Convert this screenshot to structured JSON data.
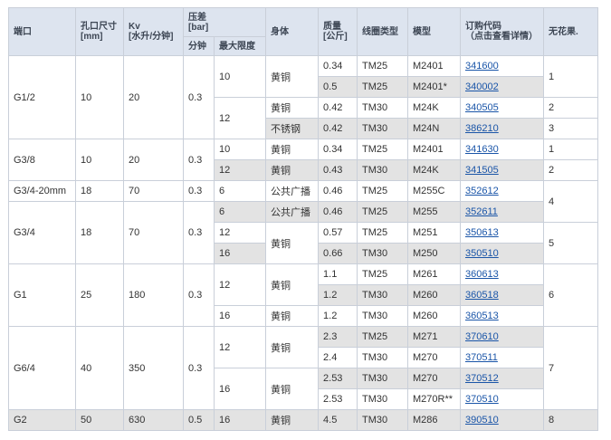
{
  "table": {
    "headers": {
      "port": "端口",
      "orifice_line1": "孔口尺寸",
      "orifice_line2": "[mm]",
      "kv_line1": "Kv",
      "kv_line2": "[水升/分钟]",
      "pressure_line1": "压差",
      "pressure_line2": "[bar]",
      "pressure_min": "分钟",
      "pressure_max": "最大限度",
      "body": "身体",
      "weight_line1": "质量",
      "weight_line2": "[公斤]",
      "coil": "线圈类型",
      "model": "模型",
      "order_line1": "订购代码",
      "order_line2": "（点击查看详情）",
      "no_flower": "无花果."
    },
    "groups": [
      {
        "port": "G1/2",
        "orifice": "10",
        "kv": "20",
        "pmin": "0.3"
      },
      {
        "port": "G3/8",
        "orifice": "10",
        "kv": "20",
        "pmin": "0.3"
      },
      {
        "port": "G3/4-20mm",
        "orifice": "18",
        "kv": "70",
        "pmin": "0.3"
      },
      {
        "port": "G3/4",
        "orifice": "18",
        "kv": "70",
        "pmin": "0.3"
      },
      {
        "port": "G1",
        "orifice": "25",
        "kv": "180",
        "pmin": "0.3"
      },
      {
        "port": "G6/4",
        "orifice": "40",
        "kv": "350",
        "pmin": "0.3"
      },
      {
        "port": "G2",
        "orifice": "50",
        "kv": "630",
        "pmin": "0.5"
      }
    ],
    "pmax": [
      "10",
      "12",
      "10",
      "12",
      "6",
      "6",
      "12",
      "16",
      "12",
      "16",
      "12",
      "16",
      "16"
    ],
    "body": [
      "黄铜",
      "黄铜",
      "不锈钢",
      "黄铜",
      "黄铜",
      "公共广播",
      "公共广播",
      "黄铜",
      "黄铜",
      "黄铜",
      "黄铜",
      "黄铜",
      "黄铜",
      "黄铜"
    ],
    "fig": [
      "1",
      "2",
      "3",
      "1",
      "2",
      "4",
      "5",
      "6",
      "7",
      "8"
    ],
    "rows": [
      {
        "weight": "0.34",
        "coil": "TM25",
        "model": "M2401",
        "code": "341600"
      },
      {
        "weight": "0.5",
        "coil": "TM25",
        "model": "M2401*",
        "code": "340002"
      },
      {
        "weight": "0.42",
        "coil": "TM30",
        "model": "M24K",
        "code": "340505"
      },
      {
        "weight": "0.42",
        "coil": "TM30",
        "model": "M24N",
        "code": "386210"
      },
      {
        "weight": "0.34",
        "coil": "TM25",
        "model": "M2401",
        "code": "341630"
      },
      {
        "weight": "0.43",
        "coil": "TM30",
        "model": "M24K",
        "code": "341505"
      },
      {
        "weight": "0.46",
        "coil": "TM25",
        "model": "M255C",
        "code": "352612"
      },
      {
        "weight": "0.46",
        "coil": "TM25",
        "model": "M255",
        "code": "352611"
      },
      {
        "weight": "0.57",
        "coil": "TM25",
        "model": "M251",
        "code": "350613"
      },
      {
        "weight": "0.66",
        "coil": "TM30",
        "model": "M250",
        "code": "350510"
      },
      {
        "weight": "1.1",
        "coil": "TM25",
        "model": "M261",
        "code": "360613"
      },
      {
        "weight": "1.2",
        "coil": "TM30",
        "model": "M260",
        "code": "360518"
      },
      {
        "weight": "1.2",
        "coil": "TM30",
        "model": "M260",
        "code": "360513"
      },
      {
        "weight": "2.3",
        "coil": "TM25",
        "model": "M271",
        "code": "370610"
      },
      {
        "weight": "2.4",
        "coil": "TM30",
        "model": "M270",
        "code": "370511"
      },
      {
        "weight": "2.53",
        "coil": "TM30",
        "model": "M270",
        "code": "370512"
      },
      {
        "weight": "2.53",
        "coil": "TM30",
        "model": "M270R**",
        "code": "370510"
      },
      {
        "weight": "4.5",
        "coil": "TM30",
        "model": "M286",
        "code": "390510"
      }
    ]
  }
}
